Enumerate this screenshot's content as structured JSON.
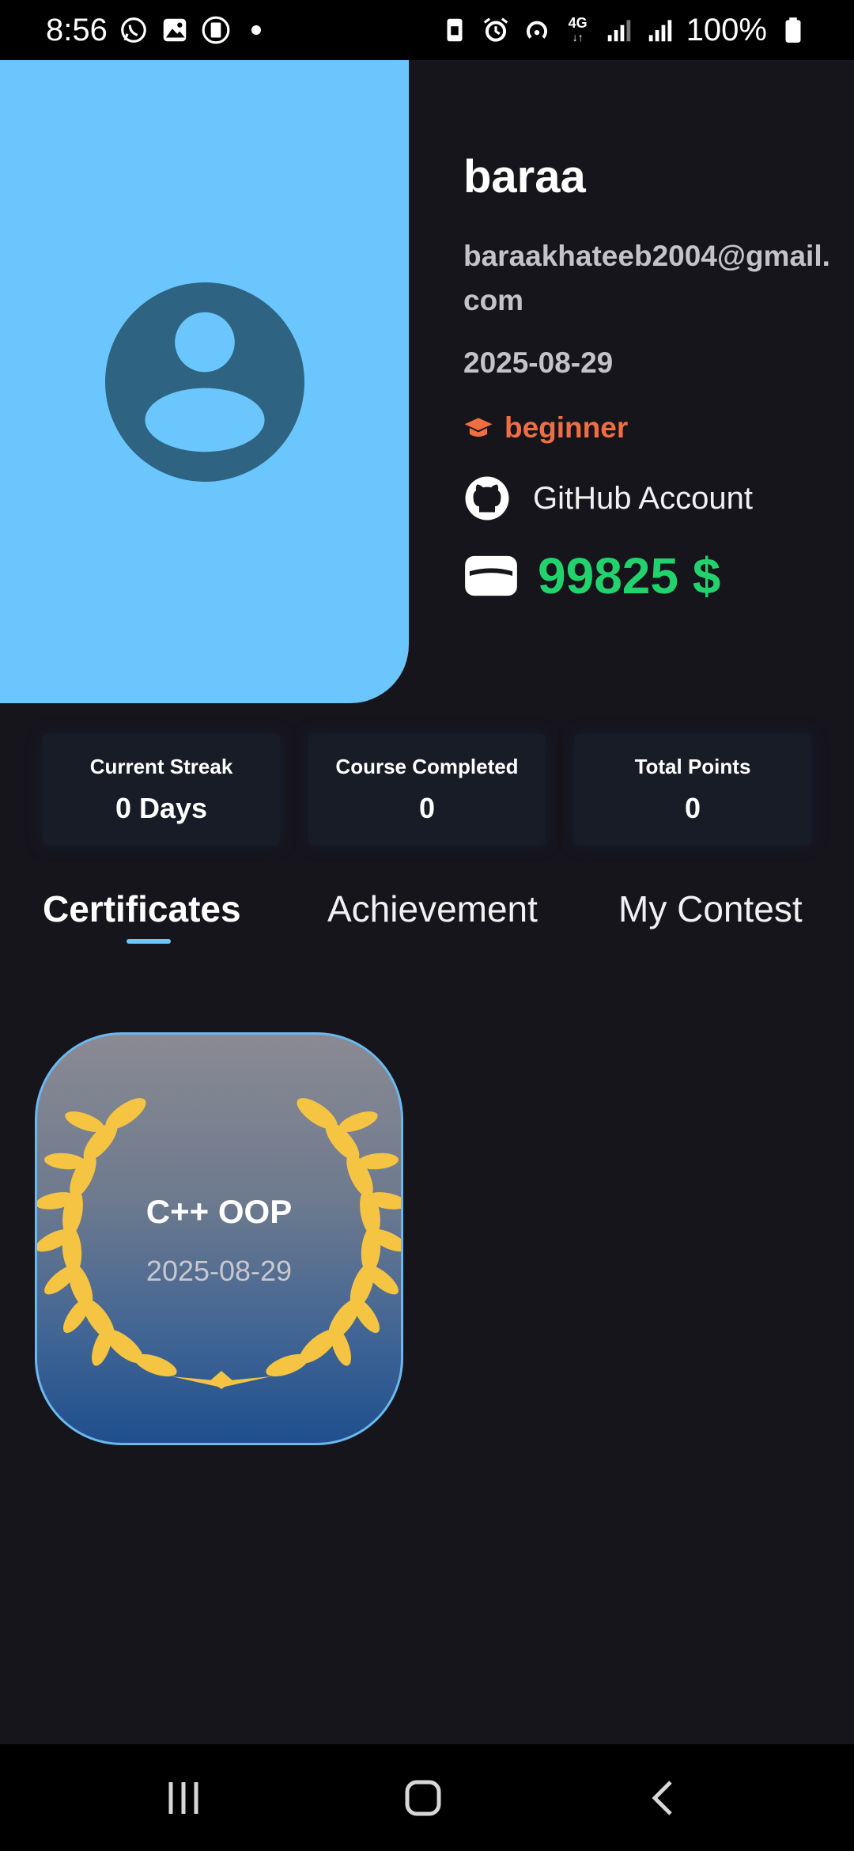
{
  "status_bar": {
    "time": "8:56",
    "left_icons": [
      "whatsapp-icon",
      "gallery-icon",
      "clipboard-icon"
    ],
    "right_icons": [
      "sim-icon",
      "alarm-icon",
      "hotspot-icon",
      "4g-icon",
      "signal-icon",
      "signal-icon",
      "battery-icon"
    ],
    "network": "4G",
    "battery": "100%"
  },
  "profile": {
    "name": "baraa",
    "email": "baraakhateeb2004@gmail.com",
    "date": "2025-08-29",
    "level": "beginner",
    "level_icon": "graduation-cap-icon",
    "github_label": "GitHub Account",
    "balance": "99825 $",
    "colors": {
      "level": "#ef6f43",
      "balance": "#22d36d",
      "avatar_bg": "#6ac6fd"
    }
  },
  "stats": [
    {
      "label": "Current Streak",
      "value": "0 Days"
    },
    {
      "label": "Course Completed",
      "value": "0"
    },
    {
      "label": "Total Points",
      "value": "0"
    }
  ],
  "tabs": [
    {
      "label": "Certificates",
      "active": true
    },
    {
      "label": "Achievement",
      "active": false
    },
    {
      "label": "My Contest",
      "active": false
    }
  ],
  "certificates": [
    {
      "title": "C++ OOP",
      "date": "2025-08-29"
    }
  ],
  "nav": [
    "recent-apps-icon",
    "home-icon",
    "back-icon"
  ]
}
